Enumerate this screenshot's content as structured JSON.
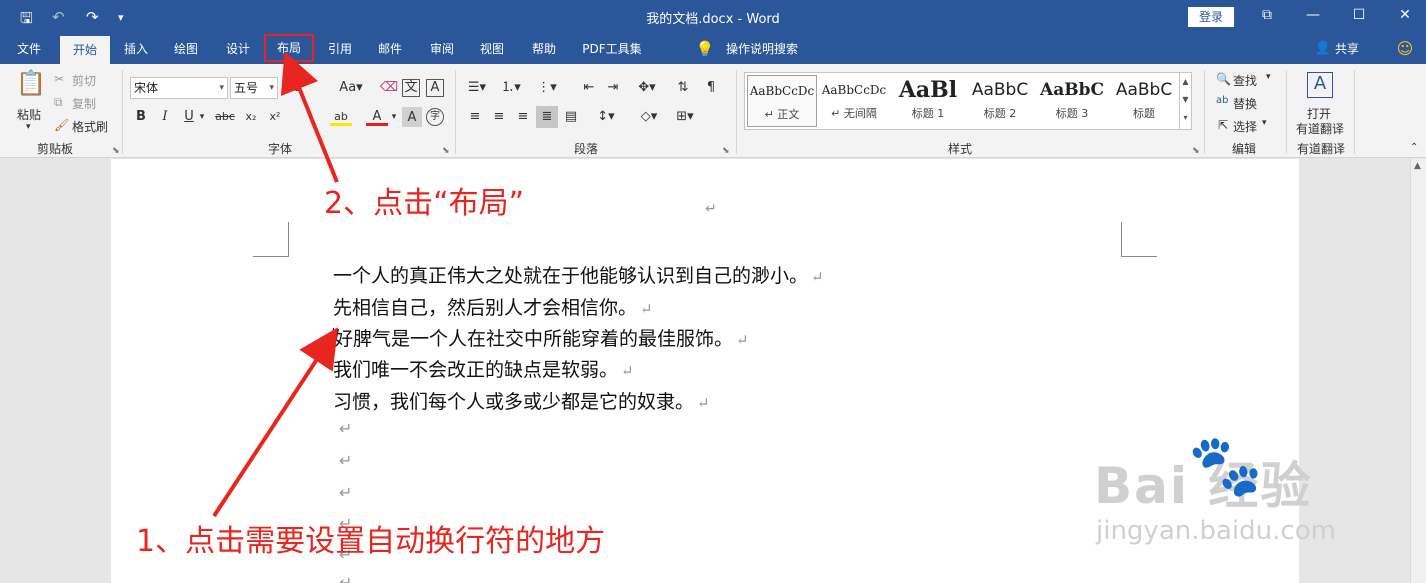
{
  "window": {
    "title": "我的文档.docx  -  Word",
    "login_label": "登录"
  },
  "tabs": [
    "文件",
    "开始",
    "插入",
    "绘图",
    "设计",
    "布局",
    "引用",
    "邮件",
    "审阅",
    "视图",
    "帮助",
    "PDF工具集"
  ],
  "tell_me": "操作说明搜索",
  "share_label": "共享",
  "clipboard": {
    "paste": "粘贴",
    "cut": "剪切",
    "copy": "复制",
    "format_painter": "格式刷",
    "group": "剪贴板"
  },
  "font": {
    "name": "宋体",
    "size": "五号",
    "group": "字体"
  },
  "paragraph": {
    "group": "段落"
  },
  "styles": {
    "group": "样式",
    "items": [
      {
        "preview": "AaBbCcDc",
        "name": "↵ 正文"
      },
      {
        "preview": "AaBbCcDc",
        "name": "↵ 无间隔"
      },
      {
        "preview": "AaBl",
        "name": "标题 1"
      },
      {
        "preview": "AaBbC",
        "name": "标题 2"
      },
      {
        "preview": "AaBbC",
        "name": "标题 3"
      },
      {
        "preview": "AaBbC",
        "name": "标题"
      }
    ]
  },
  "editing": {
    "find": "查找",
    "replace": "替换",
    "select": "选择",
    "group": "编辑"
  },
  "translate": {
    "line1": "打开",
    "line2": "有道翻译",
    "group": "有道翻译"
  },
  "document": {
    "lines": [
      "一个人的真正伟大之处就在于他能够认识到自己的渺小。",
      "先相信自己，然后别人才会相信你。",
      "好脾气是一个人在社交中所能穿着的最佳服饰。",
      "我们唯一不会改正的缺点是软弱。",
      "习惯，我们每个人或多或少都是它的奴隶。"
    ],
    "paragraph_mark": "↵"
  },
  "annotations": {
    "step2": "2、点击“布局”",
    "step1": "1、点击需要设置自动换行符的地方",
    "color": "#e8251f"
  },
  "watermark": {
    "logo": "Bai 经验",
    "url": "jingyan.baidu.com"
  }
}
